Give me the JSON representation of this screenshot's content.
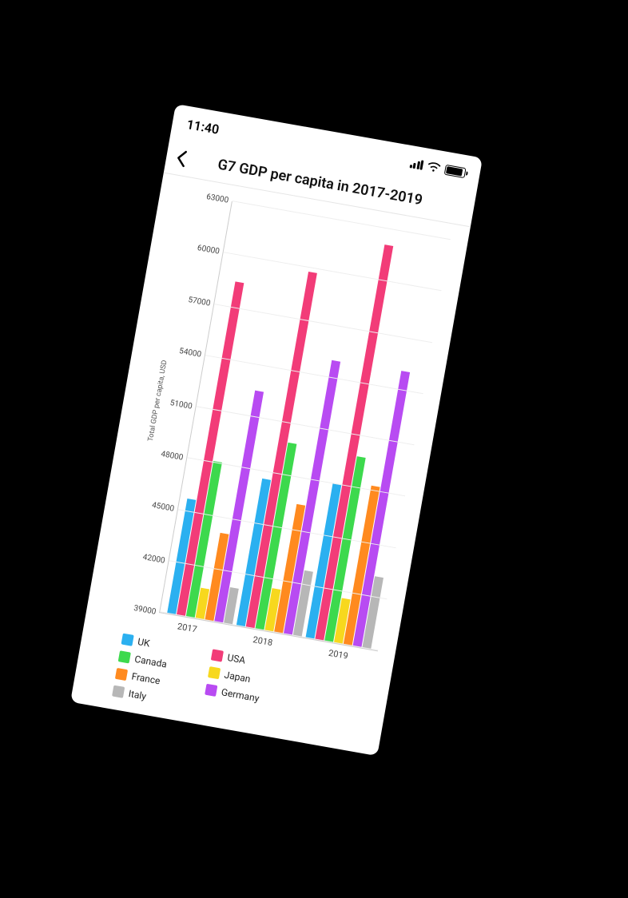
{
  "status_bar": {
    "time": "11:40"
  },
  "nav": {
    "title": "G7 GDP per capita in 2017-2019"
  },
  "colors": {
    "UK": "#2BB0F0",
    "USA": "#F23C78",
    "Canada": "#3DD94D",
    "Japan": "#F7D81E",
    "France": "#FF8A1F",
    "Germany": "#B84BF2",
    "Italy": "#B7B7B7"
  },
  "chart_data": {
    "type": "bar",
    "title": "G7 GDP per capita in 2017-2019",
    "ylabel": "Total GDP per capita, USD",
    "xlabel": "",
    "categories": [
      "2017",
      "2018",
      "2019"
    ],
    "series": [
      {
        "name": "UK",
        "values": [
          45700,
          47600,
          48000
        ]
      },
      {
        "name": "USA",
        "values": [
          58500,
          59800,
          62100
        ]
      },
      {
        "name": "Canada",
        "values": [
          48100,
          49900,
          49800
        ]
      },
      {
        "name": "Japan",
        "values": [
          40800,
          41500,
          41600
        ]
      },
      {
        "name": "France",
        "values": [
          44100,
          46500,
          48300
        ]
      },
      {
        "name": "Germany",
        "values": [
          52500,
          55000,
          55100
        ]
      },
      {
        "name": "Italy",
        "values": [
          41100,
          42800,
          43200
        ]
      }
    ],
    "ylim": [
      39000,
      63000
    ],
    "yticks": [
      39000,
      42000,
      45000,
      48000,
      51000,
      54000,
      57000,
      60000,
      63000
    ],
    "legend_position": "bottom",
    "grid": true
  },
  "legend_order": [
    "UK",
    "USA",
    "Canada",
    "Japan",
    "France",
    "Germany",
    "Italy"
  ]
}
